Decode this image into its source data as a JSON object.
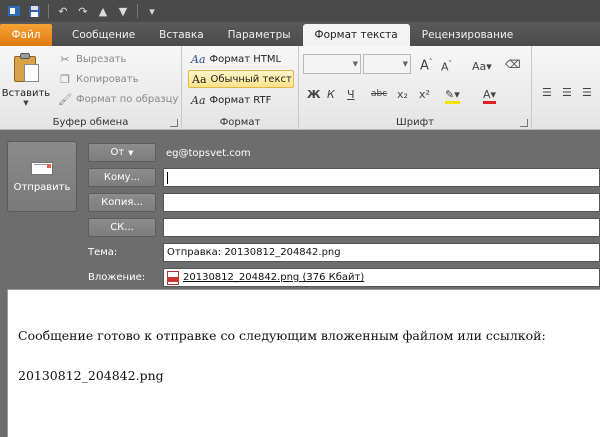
{
  "ribbon": {
    "tabs": [
      {
        "label": "Файл"
      },
      {
        "label": "Сообщение"
      },
      {
        "label": "Вставка"
      },
      {
        "label": "Параметры"
      },
      {
        "label": "Формат текста"
      },
      {
        "label": "Рецензирование"
      }
    ],
    "active_tab": "Формат текста",
    "clipboard": {
      "label": "Буфер обмена",
      "paste": "Вставить",
      "cut": "Вырезать",
      "copy": "Копировать",
      "format_painter": "Формат по образцу"
    },
    "format": {
      "label": "Формат",
      "html": "Формат HTML",
      "plain": "Обычный текст",
      "rtf": "Формат RTF",
      "selected": "Обычный текст",
      "aa": "Aa"
    },
    "font": {
      "label": "Шрифт",
      "bold": "Ж",
      "italic": "К",
      "underline": "Ч",
      "strike": "abc",
      "subscript": "x₂",
      "superscript": "x²"
    }
  },
  "header": {
    "send_label": "Отправить",
    "from_label": "От",
    "from_value": "eg@topsvet.com",
    "to_label": "Кому...",
    "cc_label": "Копия...",
    "bcc_label": "СК...",
    "to_value": "",
    "cc_value": "",
    "bcc_value": "",
    "subject_label": "Тема:",
    "subject_value": "Отправка: 20130812_204842.png",
    "attachment_label": "Вложение:",
    "attachment_value": "20130812_204842.png (376 Кбайт)"
  },
  "body": {
    "line1": "Сообщение готово к отправке со следующим вложенным файлом или ссылкой:",
    "line2": "20130812_204842.png"
  },
  "colors": {
    "file_tab": "#e8891f",
    "header_bg": "#6d6d6d",
    "ribbon_bg": "#eeeeee"
  }
}
